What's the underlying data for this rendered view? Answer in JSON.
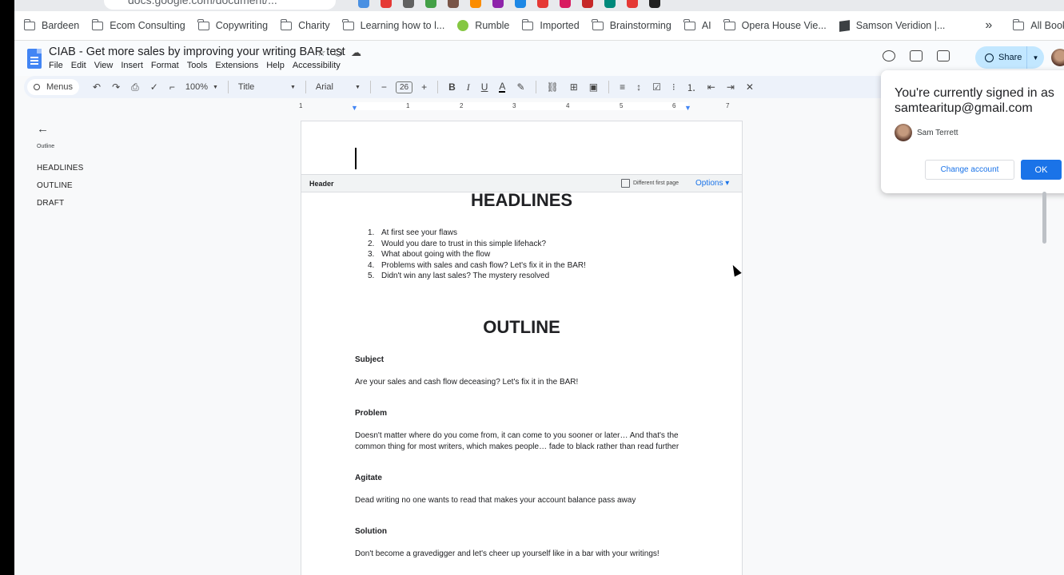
{
  "browser": {
    "url": "docs.google.com/document/..."
  },
  "bookmarks": [
    {
      "label": "Bardeen",
      "icon": "folder-icon"
    },
    {
      "label": "Ecom Consulting",
      "icon": "folder-icon"
    },
    {
      "label": "Copywriting",
      "icon": "folder-icon"
    },
    {
      "label": "Charity",
      "icon": "folder-icon"
    },
    {
      "label": "Learning how to l...",
      "icon": "folder-icon"
    },
    {
      "label": "Rumble",
      "icon": "rumble-icon"
    },
    {
      "label": "Imported",
      "icon": "folder-icon"
    },
    {
      "label": "Brainstorming",
      "icon": "folder-icon"
    },
    {
      "label": "AI",
      "icon": "folder-icon"
    },
    {
      "label": "Opera House Vie...",
      "icon": "folder-icon"
    },
    {
      "label": "Samson Veridion |...",
      "icon": "cube-icon"
    }
  ],
  "bookmarks_more": "»",
  "bookmarks_all": "All Bookmarks",
  "doc": {
    "title": "CIAB - Get more sales by improving your writing BAR test",
    "menu": [
      "File",
      "Edit",
      "View",
      "Insert",
      "Format",
      "Tools",
      "Extensions",
      "Help",
      "Accessibility"
    ],
    "share_label": "Share"
  },
  "toolbar": {
    "menus_search": "Menus",
    "zoom": "100%",
    "style": "Title",
    "font": "Arial",
    "font_size": "26",
    "minus": "−",
    "plus": "+"
  },
  "ruler_numbers": [
    "1",
    "1",
    "2",
    "3",
    "4",
    "5",
    "6",
    "7"
  ],
  "outline": {
    "label": "Outline",
    "items": [
      "HEADLINES",
      "OUTLINE",
      "DRAFT"
    ]
  },
  "page": {
    "header_label": "Header",
    "different_first_page": "Different first page",
    "options": "Options",
    "headlines_title": "HEADLINES",
    "headlines": [
      "At first see your flaws",
      "Would you dare to trust in this simple lifehack?",
      "What about going with the flow",
      "Problems with sales and cash flow? Let's fix it in the BAR!",
      "Didn't win any last sales? The mystery resolved"
    ],
    "outline_title": "OUTLINE",
    "sections": [
      {
        "heading": "Subject",
        "text": "Are your sales and cash flow deceasing? Let's fix it in the BAR!"
      },
      {
        "heading": "Problem",
        "text": "Doesn't matter where do you come from, it can come to you sooner or later… And that's the common thing for most writers, which makes people… fade to black rather than read further"
      },
      {
        "heading": "Agitate",
        "text": "Dead writing no one wants to read that makes your account balance pass away"
      },
      {
        "heading": "Solution",
        "text": "Don't become a gravedigger and let's cheer up yourself like in a bar with your writings!"
      }
    ]
  },
  "account_popup": {
    "message": "You're currently signed in as samtearitup@gmail.com",
    "name": "Sam Terrett",
    "change_account": "Change account",
    "ok": "OK"
  }
}
